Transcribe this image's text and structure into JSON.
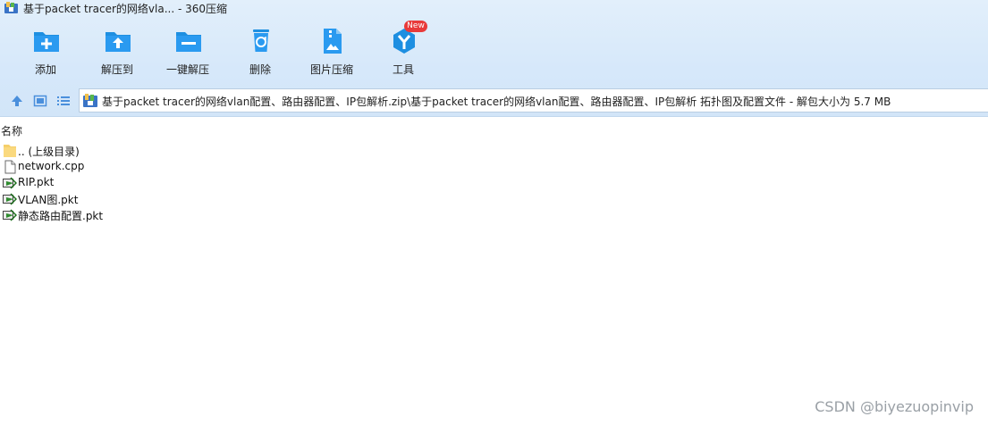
{
  "window": {
    "title": "基于packet tracer的网络vla... - 360压缩"
  },
  "toolbar": {
    "buttons": [
      {
        "label": "添加",
        "icon": "add-folder-icon"
      },
      {
        "label": "解压到",
        "icon": "extract-to-icon"
      },
      {
        "label": "一键解压",
        "icon": "one-click-extract-icon"
      },
      {
        "label": "删除",
        "icon": "recycle-bin-icon"
      },
      {
        "label": "图片压缩",
        "icon": "image-compress-icon"
      },
      {
        "label": "工具",
        "icon": "tools-icon"
      }
    ],
    "new_badge": "New"
  },
  "nav": {
    "path": "基于packet tracer的网络vlan配置、路由器配置、IP包解析.zip\\基于packet tracer的网络vlan配置、路由器配置、IP包解析 拓扑图及配置文件 - 解包大小为 5.7 MB"
  },
  "list": {
    "column_name": "名称",
    "items": [
      {
        "name": ".. (上级目录)",
        "icon": "folder-icon"
      },
      {
        "name": "network.cpp",
        "icon": "document-icon"
      },
      {
        "name": "RIP.pkt",
        "icon": "packet-tracer-file-icon"
      },
      {
        "name": "VLAN图.pkt",
        "icon": "packet-tracer-file-icon"
      },
      {
        "name": "静态路由配置.pkt",
        "icon": "packet-tracer-file-icon"
      }
    ]
  },
  "watermark": "CSDN @biyezuopinvip",
  "colors": {
    "toolbar_bg": "#d6e8fa",
    "icon_blue": "#1e8fe1",
    "badge_red": "#e83a3a"
  }
}
